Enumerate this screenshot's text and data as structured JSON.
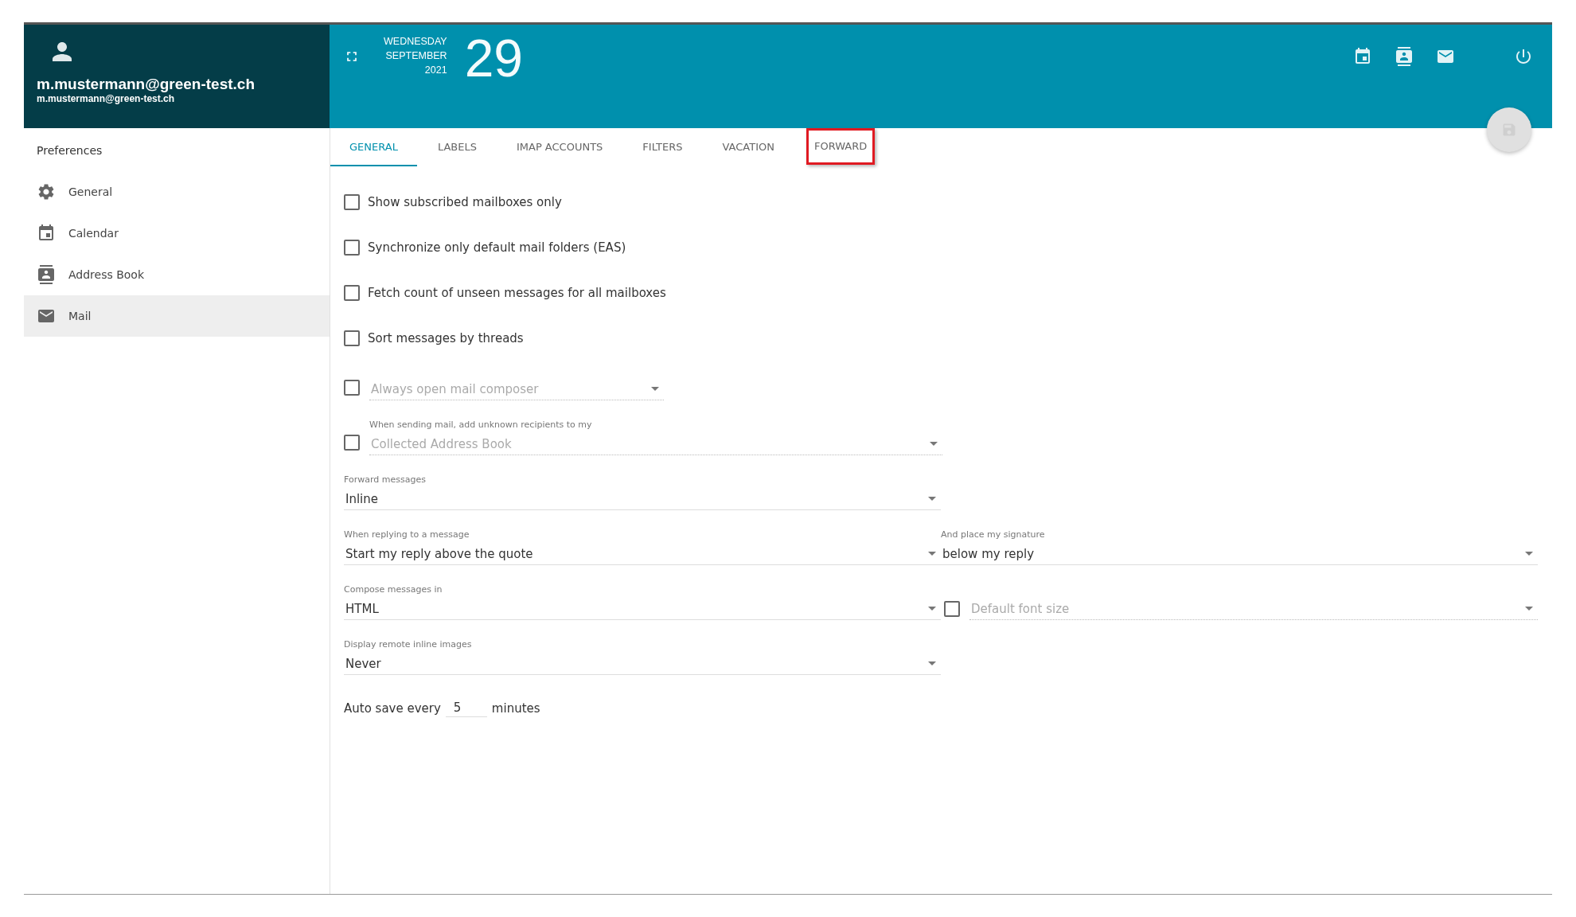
{
  "user": {
    "name": "m.mustermann@green-test.ch",
    "email": "m.mustermann@green-test.ch"
  },
  "date": {
    "weekday": "WEDNESDAY",
    "month": "SEPTEMBER",
    "year": "2021",
    "day": "29"
  },
  "sidebar": {
    "title": "Preferences",
    "items": [
      {
        "label": "General",
        "selected": false
      },
      {
        "label": "Calendar",
        "selected": false
      },
      {
        "label": "Address Book",
        "selected": false
      },
      {
        "label": "Mail",
        "selected": true
      }
    ]
  },
  "tabs": [
    {
      "label": "GENERAL",
      "selected": true,
      "highlighted": false
    },
    {
      "label": "LABELS",
      "selected": false,
      "highlighted": false
    },
    {
      "label": "IMAP ACCOUNTS",
      "selected": false,
      "highlighted": false
    },
    {
      "label": "FILTERS",
      "selected": false,
      "highlighted": false
    },
    {
      "label": "VACATION",
      "selected": false,
      "highlighted": false
    },
    {
      "label": "FORWARD",
      "selected": false,
      "highlighted": true
    }
  ],
  "checkboxes": [
    {
      "label": "Show subscribed mailboxes only",
      "checked": false
    },
    {
      "label": "Synchronize only default mail folders (EAS)",
      "checked": false
    },
    {
      "label": "Fetch count of unseen messages for all mailboxes",
      "checked": false
    },
    {
      "label": "Sort messages by threads",
      "checked": false
    }
  ],
  "optional_selects": [
    {
      "placeholder": "Always open mail composer",
      "checked": false
    },
    {
      "caption": "When sending mail, add unknown recipients to my",
      "placeholder": "Collected Address Book",
      "checked": false
    }
  ],
  "select_rows": [
    [
      {
        "kind": "select",
        "label": "Forward messages",
        "value": "Inline"
      }
    ],
    [
      {
        "kind": "select",
        "label": "When replying to a message",
        "value": "Start my reply above the quote"
      },
      {
        "kind": "select",
        "label": "And place my signature",
        "value": "below my reply"
      }
    ],
    [
      {
        "kind": "select",
        "label": "Compose messages in",
        "value": "HTML"
      },
      {
        "kind": "optional",
        "placeholder": "Default font size",
        "checked": false
      }
    ],
    [
      {
        "kind": "select",
        "label": "Display remote inline images",
        "value": "Never"
      }
    ]
  ],
  "autosave": {
    "before": "Auto save every",
    "value": "5",
    "after": "minutes"
  }
}
